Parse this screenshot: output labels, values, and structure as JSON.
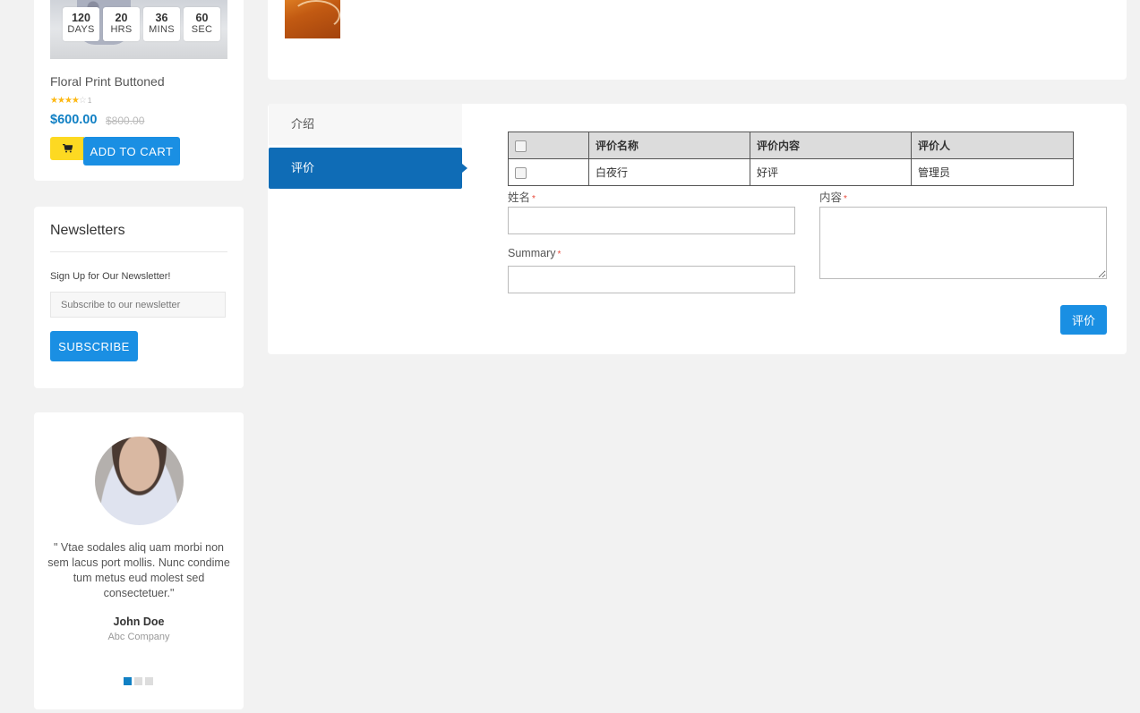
{
  "product": {
    "countdown": [
      {
        "value": "120",
        "unit": "DAYS"
      },
      {
        "value": "20",
        "unit": "HRS"
      },
      {
        "value": "36",
        "unit": "MINS"
      },
      {
        "value": "60",
        "unit": "SEC"
      }
    ],
    "name": "Floral Print Buttoned",
    "rating_stars": 4,
    "rating_max": 5,
    "rating_count": "1",
    "price_new": "$600.00",
    "price_old": "$800.00",
    "add_to_cart_label": "ADD TO CART",
    "cart_icon": "shopping-cart-icon"
  },
  "newsletter": {
    "title": "Newsletters",
    "subtitle": "Sign Up for Our Newsletter!",
    "input_placeholder": "Subscribe to our newsletter",
    "button_label": "SUBSCRIBE"
  },
  "testimonial": {
    "quote": "\" Vtae sodales aliq uam morbi non sem lacus port mollis. Nunc condime tum metus eud molest sed consectetuer.\"",
    "name": "John Doe",
    "company": "Abc Company",
    "slides": 3,
    "active_slide": 1
  },
  "tabs": [
    {
      "label": "介绍",
      "active": false
    },
    {
      "label": "评价",
      "active": true
    }
  ],
  "reviews_table": {
    "headers": [
      "评价名称",
      "评价内容",
      "评价人"
    ],
    "rows": [
      [
        "白夜行",
        "好评",
        "管理员"
      ]
    ]
  },
  "review_form": {
    "name_label": "姓名",
    "summary_label": "Summary",
    "content_label": "内容",
    "required_mark": "*",
    "submit_label": "评价"
  },
  "colors": {
    "accent": "#1a8fe3",
    "tab_active": "#0f6cb6",
    "price": "#1180c4",
    "cart_yellow": "#fdd922",
    "star": "#fdb813"
  }
}
